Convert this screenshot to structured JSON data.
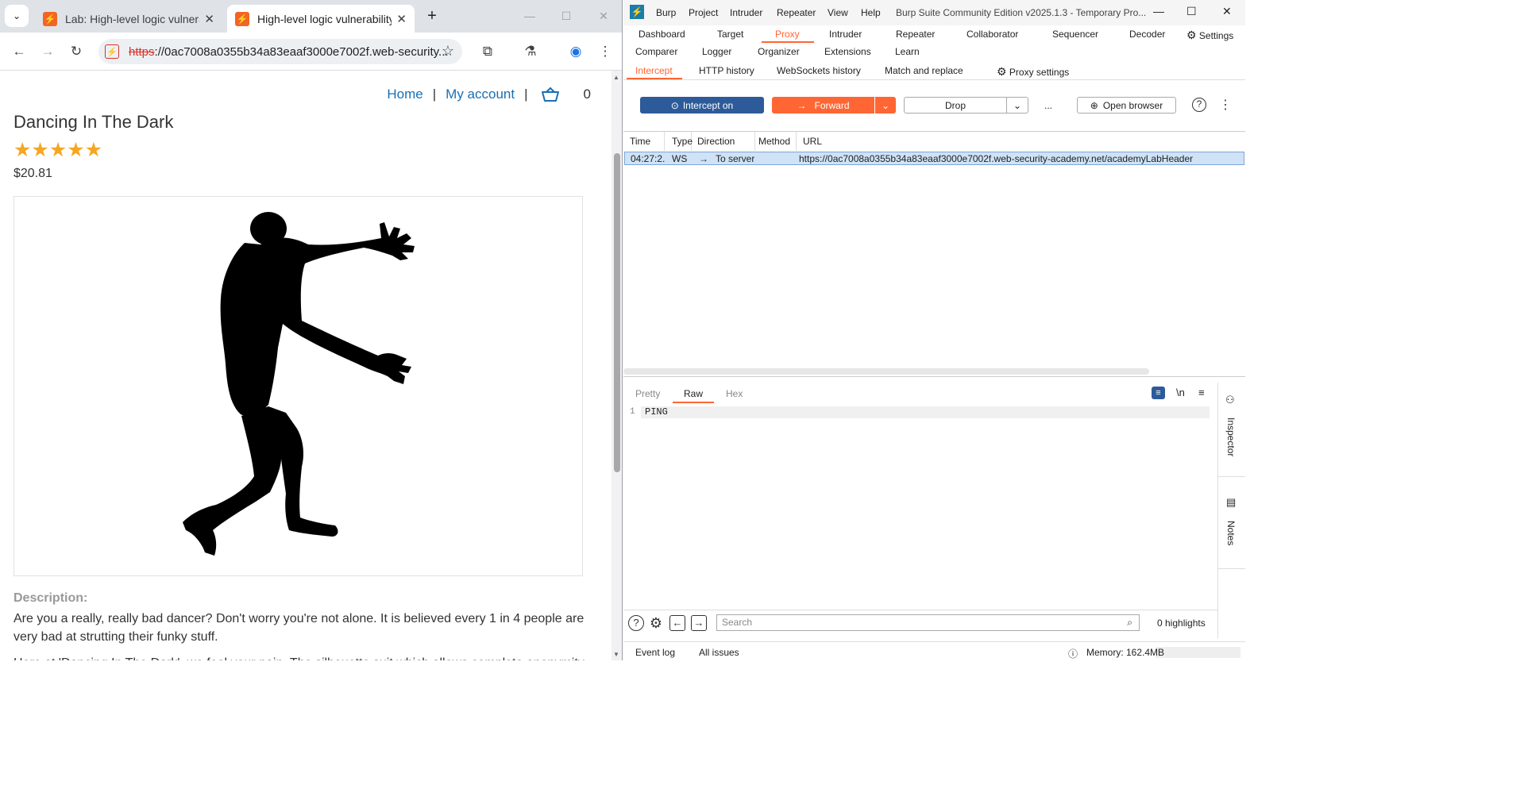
{
  "chrome": {
    "tabs": [
      {
        "title": "Lab: High-level logic vulnerabilit",
        "active": false
      },
      {
        "title": "High-level logic vulnerability",
        "active": true
      }
    ],
    "url_scheme": "https",
    "url_rest": "://0ac7008a0355b34a83eaaf3000e7002f.web-security...",
    "page": {
      "nav_home": "Home",
      "nav_sep": "|",
      "nav_account": "My account",
      "cart_count": "0",
      "product_title": "Dancing In The Dark",
      "rating_stars": "★★★★★",
      "rating_value": 5,
      "price": "$20.81",
      "description_label": "Description:",
      "description_p1": "Are you a really, really bad dancer? Don't worry you're not alone. It is believed every 1 in 4 people are very bad at strutting their funky stuff.",
      "description_p2": "Here at 'Dancing In The Dark', we feel your pain. The silhouette suit which allows complete anonymity"
    }
  },
  "burp": {
    "menu": [
      "Burp",
      "Project",
      "Intruder",
      "Repeater",
      "View",
      "Help"
    ],
    "window_title": "Burp Suite Community Edition v2025.1.3 - Temporary Pro...",
    "tabs_row1": [
      "Dashboard",
      "Target",
      "Proxy",
      "Intruder",
      "Repeater",
      "Collaborator",
      "Sequencer",
      "Decoder",
      "Settings"
    ],
    "tabs_row2": [
      "Comparer",
      "Logger",
      "Organizer",
      "Extensions",
      "Learn"
    ],
    "selected_tab": "Proxy",
    "proxy_subtabs": [
      "Intercept",
      "HTTP history",
      "WebSockets history",
      "Match and replace",
      "Proxy settings"
    ],
    "selected_subtab": "Intercept",
    "buttons": {
      "intercept": "Intercept on",
      "forward": "Forward",
      "drop": "Drop",
      "more": "...",
      "open_browser": "Open browser"
    },
    "table": {
      "columns": [
        "Time",
        "Type",
        "Direction",
        "Method",
        "URL"
      ],
      "rows": [
        {
          "time": "04:27:2...",
          "type": "WS",
          "direction": "To server",
          "method": "",
          "url": "https://0ac7008a0355b34a83eaaf3000e7002f.web-security-academy.net/academyLabHeader"
        }
      ]
    },
    "editor": {
      "tabs": [
        "Pretty",
        "Raw",
        "Hex"
      ],
      "selected_tab": "Raw",
      "line_number": "1",
      "content": "PING",
      "newline_toggle": "\\n"
    },
    "side_panels": [
      "Inspector",
      "Notes"
    ],
    "search_placeholder": "Search",
    "highlights": "0 highlights",
    "status": {
      "event_log": "Event log",
      "all_issues": "All issues",
      "memory": "Memory: 162.4MB"
    },
    "colors": {
      "accent": "#ff6633",
      "intercept_blue": "#2d5b9a",
      "row_selected": "#cfe2f6"
    }
  }
}
